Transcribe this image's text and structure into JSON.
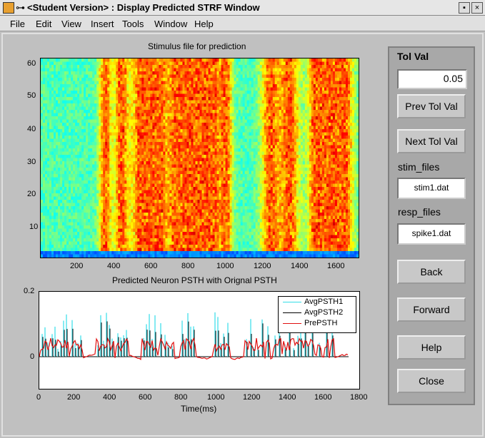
{
  "window": {
    "title": "<Student Version> : Display Predicted STRF Window",
    "icon_glyph": "⊶",
    "min_glyph": "▪",
    "close_glyph": "×"
  },
  "menu": [
    "File",
    "Edit",
    "View",
    "Insert",
    "Tools",
    "Window",
    "Help"
  ],
  "top_plot": {
    "title": "Stimulus file for prediction",
    "y_ticks": [
      "60",
      "50",
      "40",
      "30",
      "20",
      "10"
    ],
    "x_ticks": [
      "200",
      "400",
      "600",
      "800",
      "1000",
      "1200",
      "1400",
      "1600"
    ],
    "colormap": "jet"
  },
  "bottom_plot": {
    "title": "Predicted Neuron PSTH with Orignal PSTH",
    "xlabel": "Time(ms)",
    "y_ticks": [
      "0.2",
      "0"
    ],
    "x_ticks": [
      "0",
      "200",
      "400",
      "600",
      "800",
      "1000",
      "1200",
      "1400",
      "1600",
      "1800"
    ],
    "legend": [
      {
        "name": "AvgPSTH1",
        "color": "#33dde8"
      },
      {
        "name": "AvgPSTH2",
        "color": "#000000"
      },
      {
        "name": "PrePSTH",
        "color": "#e01010"
      }
    ]
  },
  "panel": {
    "tol_label": "Tol Val",
    "tol_value": "0.05",
    "prev_button": "Prev Tol Val",
    "next_button": "Next Tol Val",
    "stim_label": "stim_files",
    "stim_value": "stim1.dat",
    "resp_label": "resp_files",
    "resp_value": "spike1.dat",
    "back_button": "Back",
    "forward_button": "Forward",
    "help_button": "Help",
    "close_button": "Close"
  }
}
